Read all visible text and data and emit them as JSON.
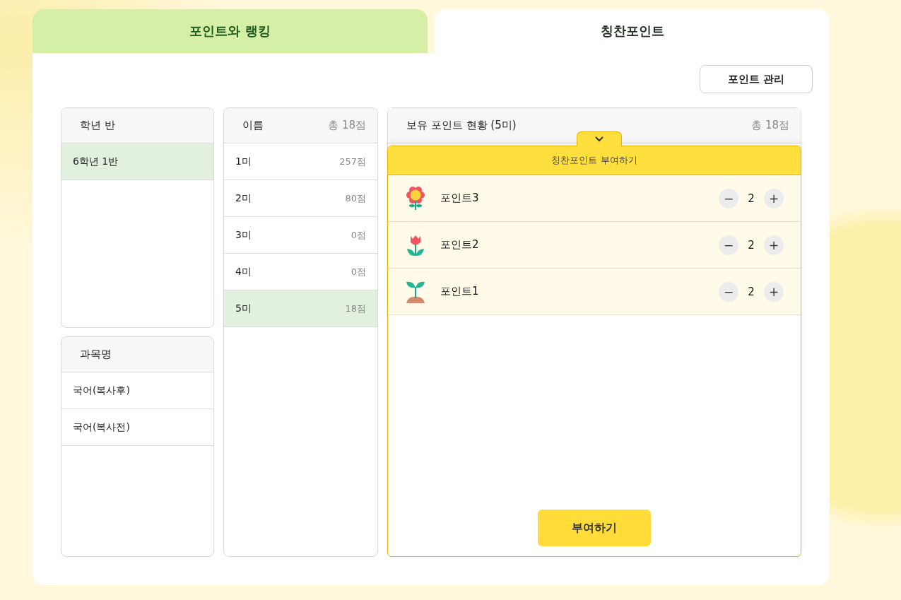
{
  "tabs": [
    {
      "label": "포인트와 랭킹",
      "selected": false
    },
    {
      "label": "칭찬포인트",
      "selected": true
    }
  ],
  "manage_button": "포인트 관리",
  "class_panel": {
    "title": "학년 반",
    "items": [
      {
        "label": "6학년 1반",
        "selected": true
      }
    ]
  },
  "subject_panel": {
    "title": "과목명",
    "items": [
      {
        "label": "국어(복사후)",
        "selected": false
      },
      {
        "label": "국어(복사전)",
        "selected": false
      }
    ]
  },
  "student_panel": {
    "title": "이름",
    "total": "총 18점",
    "items": [
      {
        "name": "1미",
        "points": "257점",
        "selected": false
      },
      {
        "name": "2미",
        "points": "80점",
        "selected": false
      },
      {
        "name": "3미",
        "points": "0점",
        "selected": false
      },
      {
        "name": "4미",
        "points": "0점",
        "selected": false
      },
      {
        "name": "5미",
        "points": "18점",
        "selected": true
      }
    ]
  },
  "holdings_panel": {
    "title": "보유 포인트 현황 (5미)",
    "total": "총 18점"
  },
  "award_drawer": {
    "title": "칭찬포인트 부여하기",
    "items": [
      {
        "label": "포인트3",
        "count": "2",
        "minus": "−",
        "plus": "+"
      },
      {
        "label": "포인트2",
        "count": "2",
        "minus": "−",
        "plus": "+"
      },
      {
        "label": "포인트1",
        "count": "2",
        "minus": "−",
        "plus": "+"
      }
    ],
    "submit": "부여하기"
  }
}
